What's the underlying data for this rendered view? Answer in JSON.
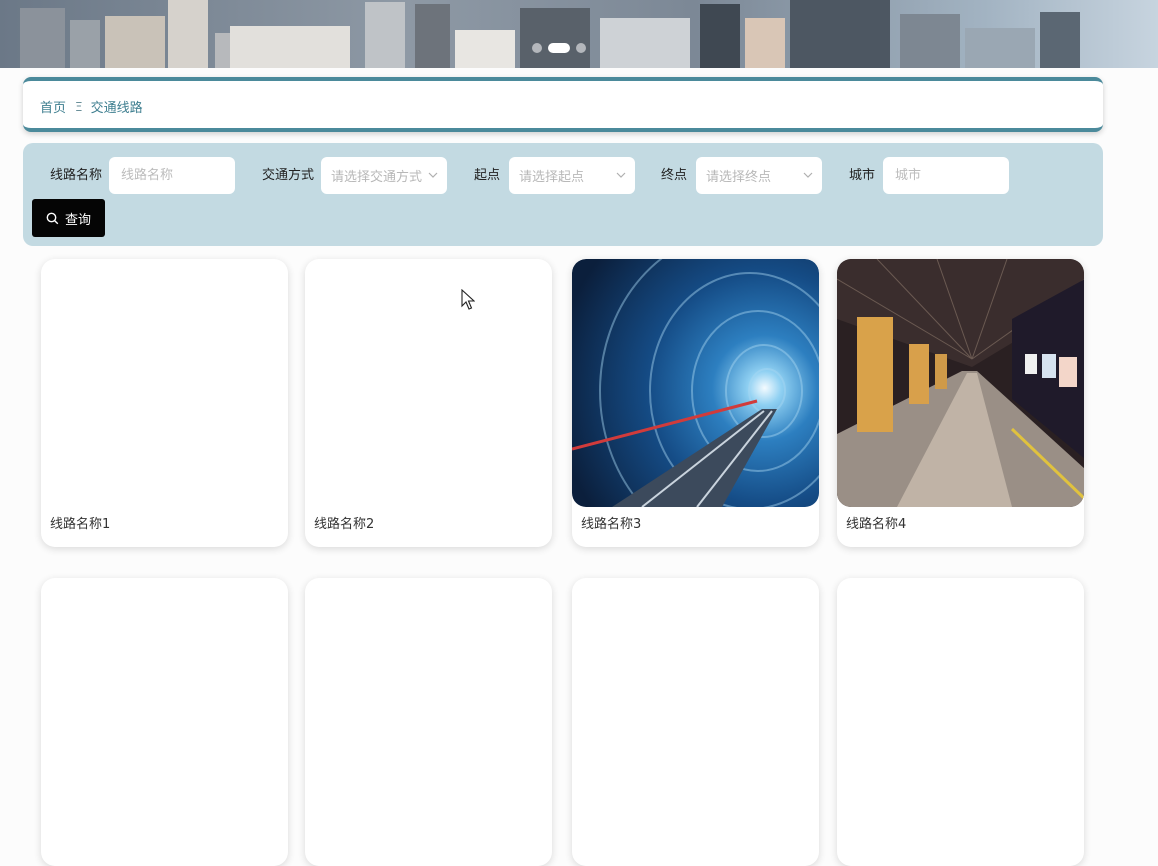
{
  "banner": {
    "slides": 3,
    "active_slide": 2
  },
  "breadcrumb": {
    "home": "首页",
    "separator": "Ξ",
    "current": "交通线路"
  },
  "search": {
    "route_name_label": "线路名称",
    "route_name_placeholder": "线路名称",
    "transport_label": "交通方式",
    "transport_placeholder": "请选择交通方式",
    "start_label": "起点",
    "start_placeholder": "请选择起点",
    "end_label": "终点",
    "end_placeholder": "请选择终点",
    "city_label": "城市",
    "city_placeholder": "城市",
    "query_label": "查询"
  },
  "cards": [
    {
      "name": "线路名称1",
      "image": "none"
    },
    {
      "name": "线路名称2",
      "image": "none"
    },
    {
      "name": "线路名称3",
      "image": "subway-tunnel"
    },
    {
      "name": "线路名称4",
      "image": "subway-platform"
    },
    {
      "name": "",
      "image": "none"
    },
    {
      "name": "",
      "image": "none"
    },
    {
      "name": "",
      "image": "none"
    },
    {
      "name": "",
      "image": "none"
    }
  ],
  "colors": {
    "accent": "#4b8a9b",
    "search_bg": "#c3dae2",
    "button_bg": "#050505"
  }
}
